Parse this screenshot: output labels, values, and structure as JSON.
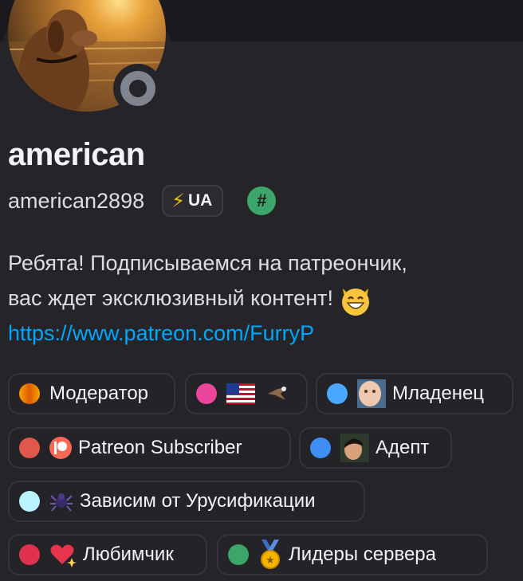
{
  "profile": {
    "display_name": "american",
    "username": "american2898",
    "tag": "UA",
    "hash_badge": "#",
    "status": "offline",
    "bio_line1": "Ребята! Подписываемся на патреончик,",
    "bio_line2": "вас ждет эксклюзивный контент!",
    "bio_link": "https://www.patreon.com/FurryP"
  },
  "roles": [
    {
      "label": "Модератор",
      "color": "#e8a000",
      "icon": "none"
    },
    {
      "label": "",
      "color": "#eb459e",
      "icon": "us-flag-eagle-icon"
    },
    {
      "label": "Младенец",
      "color": "#4aa8ff",
      "icon": "baby-photo-icon"
    },
    {
      "label": "Patreon Subscriber",
      "color": "#e0574b",
      "icon": "patreon-icon"
    },
    {
      "label": "Адепт",
      "color": "#3d8ef5",
      "icon": "face-photo-icon"
    },
    {
      "label": "Зависим от Урусификации",
      "color": "#b9f3ff",
      "icon": "spider-icon"
    },
    {
      "label": "Любимчик",
      "color": "#e0304e",
      "icon": "sparkle-heart-icon"
    },
    {
      "label": "Лидеры сервера",
      "color": "#3ba56a",
      "icon": "medal-icon"
    }
  ]
}
